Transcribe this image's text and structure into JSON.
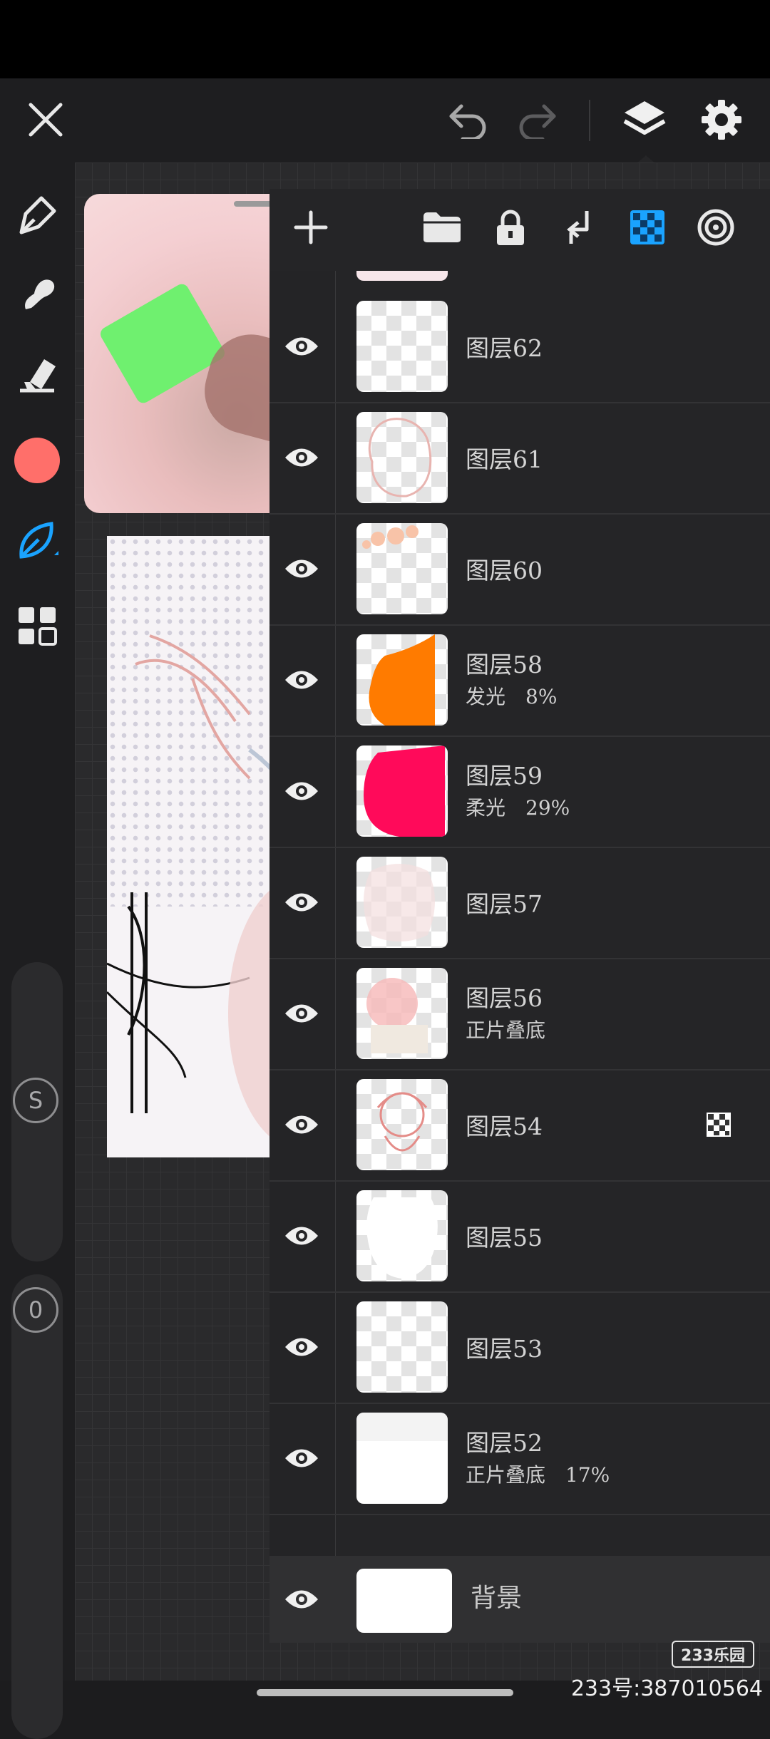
{
  "layers": [
    {
      "name": "图层62",
      "sub": ""
    },
    {
      "name": "图层61",
      "sub": ""
    },
    {
      "name": "图层60",
      "sub": ""
    },
    {
      "name": "图层58",
      "sub": "发光　8%"
    },
    {
      "name": "图层59",
      "sub": "柔光　29%"
    },
    {
      "name": "图层57",
      "sub": ""
    },
    {
      "name": "图层56",
      "sub": "正片叠底"
    },
    {
      "name": "图层54",
      "sub": ""
    },
    {
      "name": "图层55",
      "sub": ""
    },
    {
      "name": "图层53",
      "sub": ""
    },
    {
      "name": "图层52",
      "sub": "正片叠底　17%"
    }
  ],
  "background_layer": {
    "name": "背景"
  },
  "sliders": {
    "size_label": "S",
    "opacity_label": "0"
  },
  "colors": {
    "current_color": "#ff6f6a",
    "accent": "#1aa3ff"
  },
  "watermark": {
    "logo": "233乐园",
    "id": "233号:387010564"
  }
}
